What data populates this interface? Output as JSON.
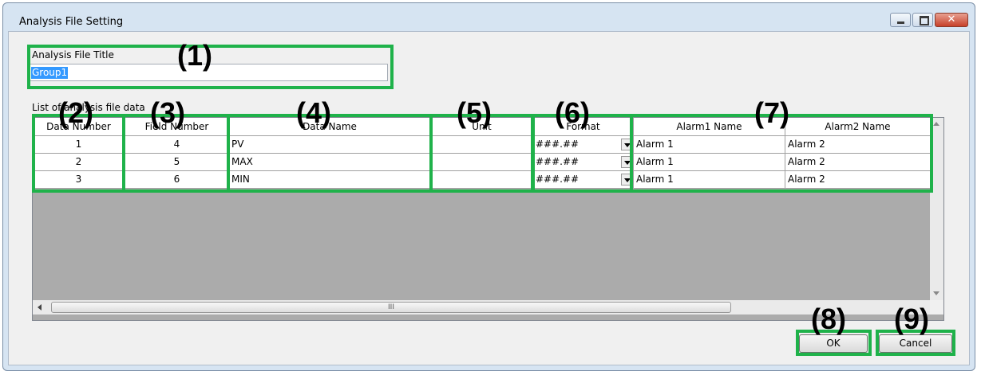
{
  "window": {
    "title": "Analysis File Setting",
    "controls": {
      "minimize": "minimize-icon",
      "maximize": "maximize-icon",
      "close": "close-icon"
    }
  },
  "form": {
    "title_label": "Analysis File Title",
    "title_value": "Group1",
    "list_label": "List of analysis file data"
  },
  "grid": {
    "columns": [
      "Data Number",
      "Field Number",
      "Data Name",
      "Unit",
      "Format",
      "Alarm1 Name",
      "Alarm2 Name"
    ],
    "rows": [
      {
        "data_number": "1",
        "field_number": "4",
        "data_name": "PV",
        "unit": "",
        "format": "###.##",
        "alarm1": "Alarm 1",
        "alarm2": "Alarm 2"
      },
      {
        "data_number": "2",
        "field_number": "5",
        "data_name": "MAX",
        "unit": "",
        "format": "###.##",
        "alarm1": "Alarm 1",
        "alarm2": "Alarm 2"
      },
      {
        "data_number": "3",
        "field_number": "6",
        "data_name": "MIN",
        "unit": "",
        "format": "###.##",
        "alarm1": "Alarm 1",
        "alarm2": "Alarm 2"
      }
    ],
    "scroll_grip": "III"
  },
  "buttons": {
    "ok": "OK",
    "cancel": "Cancel"
  },
  "callouts": [
    "(1)",
    "(2)",
    "(3)",
    "(4)",
    "(5)",
    "(6)",
    "(7)",
    "(8)",
    "(9)"
  ],
  "colors": {
    "callout_box": "#1fb24a",
    "selection": "#3399ff",
    "grid_background": "#ababab"
  }
}
